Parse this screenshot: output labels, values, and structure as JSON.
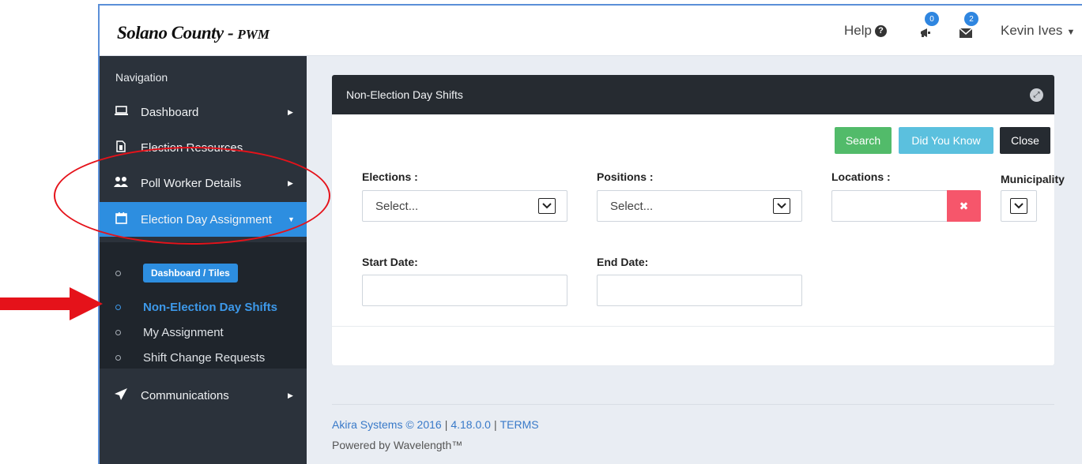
{
  "header": {
    "brand_main": "Solano County",
    "brand_sep": " - ",
    "brand_sub": "PWM",
    "help_label": "Help",
    "announcements_count": "0",
    "messages_count": "2",
    "user_name": "Kevin Ives"
  },
  "sidebar": {
    "heading": "Navigation",
    "items": [
      {
        "label": "Dashboard",
        "icon": "laptop-icon"
      },
      {
        "label": "Election Resources",
        "icon": "document-icon"
      },
      {
        "label": "Poll Worker Details",
        "icon": "users-icon"
      },
      {
        "label": "Election Day Assignment",
        "icon": "calendar-icon"
      }
    ],
    "submenu": [
      {
        "label": "Dashboard / Tiles"
      },
      {
        "label": "Non-Election Day Shifts"
      },
      {
        "label": "My Assignment"
      },
      {
        "label": "Shift Change Requests"
      }
    ],
    "communications": {
      "label": "Communications",
      "icon": "paper-plane-icon"
    }
  },
  "panel": {
    "title": "Non-Election Day Shifts",
    "buttons": {
      "search": "Search",
      "did_you_know": "Did You Know",
      "close": "Close"
    },
    "fields": {
      "elections_label": "Elections :",
      "elections_value": "Select...",
      "positions_label": "Positions :",
      "positions_value": "Select...",
      "locations_label": "Locations :",
      "municipality_label": "Municipality",
      "start_date_label": "Start Date:",
      "end_date_label": "End Date:"
    }
  },
  "footer": {
    "copyright": "Akira Systems © 2016",
    "version": "4.18.0.0",
    "terms": "TERMS",
    "powered_by": "Powered by Wavelength™"
  },
  "colors": {
    "accent": "#2d8ee0",
    "sidebar": "#2b323b",
    "search_button": "#52bb6a",
    "info_button": "#5bc0de",
    "danger_button": "#f6566b",
    "annotation": "#e5121a"
  }
}
